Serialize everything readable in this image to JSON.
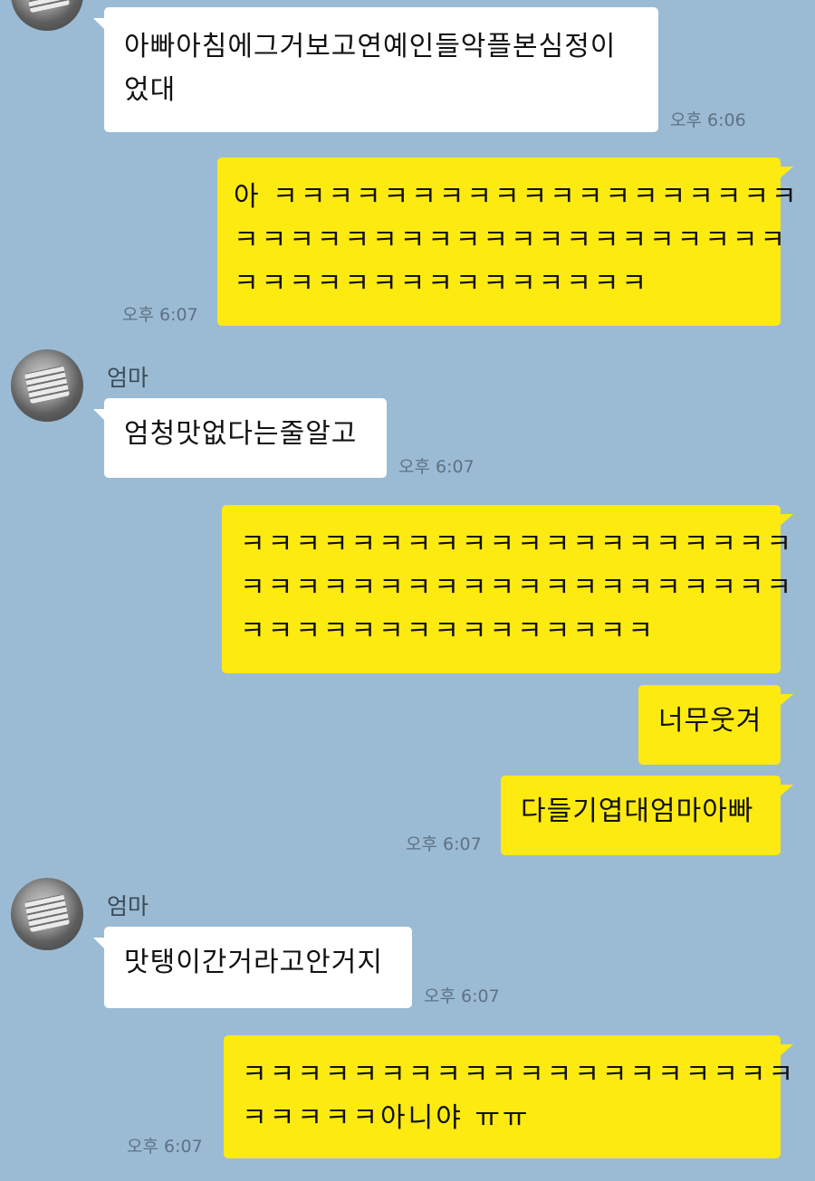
{
  "messages": [
    {
      "from": "엄마",
      "text": "아빠아침에그거보고연예인들악플본심정이\n었대",
      "time": "오후 6:06"
    },
    {
      "from": "me",
      "text": "아 ㅋㅋㅋㅋㅋㅋㅋㅋㅋㅋㅋㅋㅋㅋㅋㅋㅋㅋㅋ\nㅋㅋㅋㅋㅋㅋㅋㅋㅋㅋㅋㅋㅋㅋㅋㅋㅋㅋㅋㅋ\nㅋㅋㅋㅋㅋㅋㅋㅋㅋㅋㅋㅋㅋㅋㅋ",
      "time": "오후 6:07"
    },
    {
      "from": "엄마",
      "sender_label": "엄마",
      "text": "엄청맛없다는줄알고",
      "time": "오후 6:07"
    },
    {
      "from": "me",
      "text": "ㅋㅋㅋㅋㅋㅋㅋㅋㅋㅋㅋㅋㅋㅋㅋㅋㅋㅋㅋㅋ\nㅋㅋㅋㅋㅋㅋㅋㅋㅋㅋㅋㅋㅋㅋㅋㅋㅋㅋㅋㅋ\nㅋㅋㅋㅋㅋㅋㅋㅋㅋㅋㅋㅋㅋㅋㅋ"
    },
    {
      "from": "me",
      "text": "너무웃겨"
    },
    {
      "from": "me",
      "text": "다들기엽대엄마아빠",
      "time": "오후 6:07"
    },
    {
      "from": "엄마",
      "sender_label": "엄마",
      "text": "맛탱이간거라고안거지",
      "time": "오후 6:07"
    },
    {
      "from": "me",
      "text": "ㅋㅋㅋㅋㅋㅋㅋㅋㅋㅋㅋㅋㅋㅋㅋㅋㅋㅋㅋㅋ\nㅋㅋㅋㅋㅋ아니야 ㅠㅠ",
      "time": "오후 6:07"
    }
  ],
  "colors": {
    "background": "#9bbbd4",
    "incoming_bubble": "#ffffff",
    "outgoing_bubble": "#fcea11",
    "timestamp": "#5f7183"
  }
}
